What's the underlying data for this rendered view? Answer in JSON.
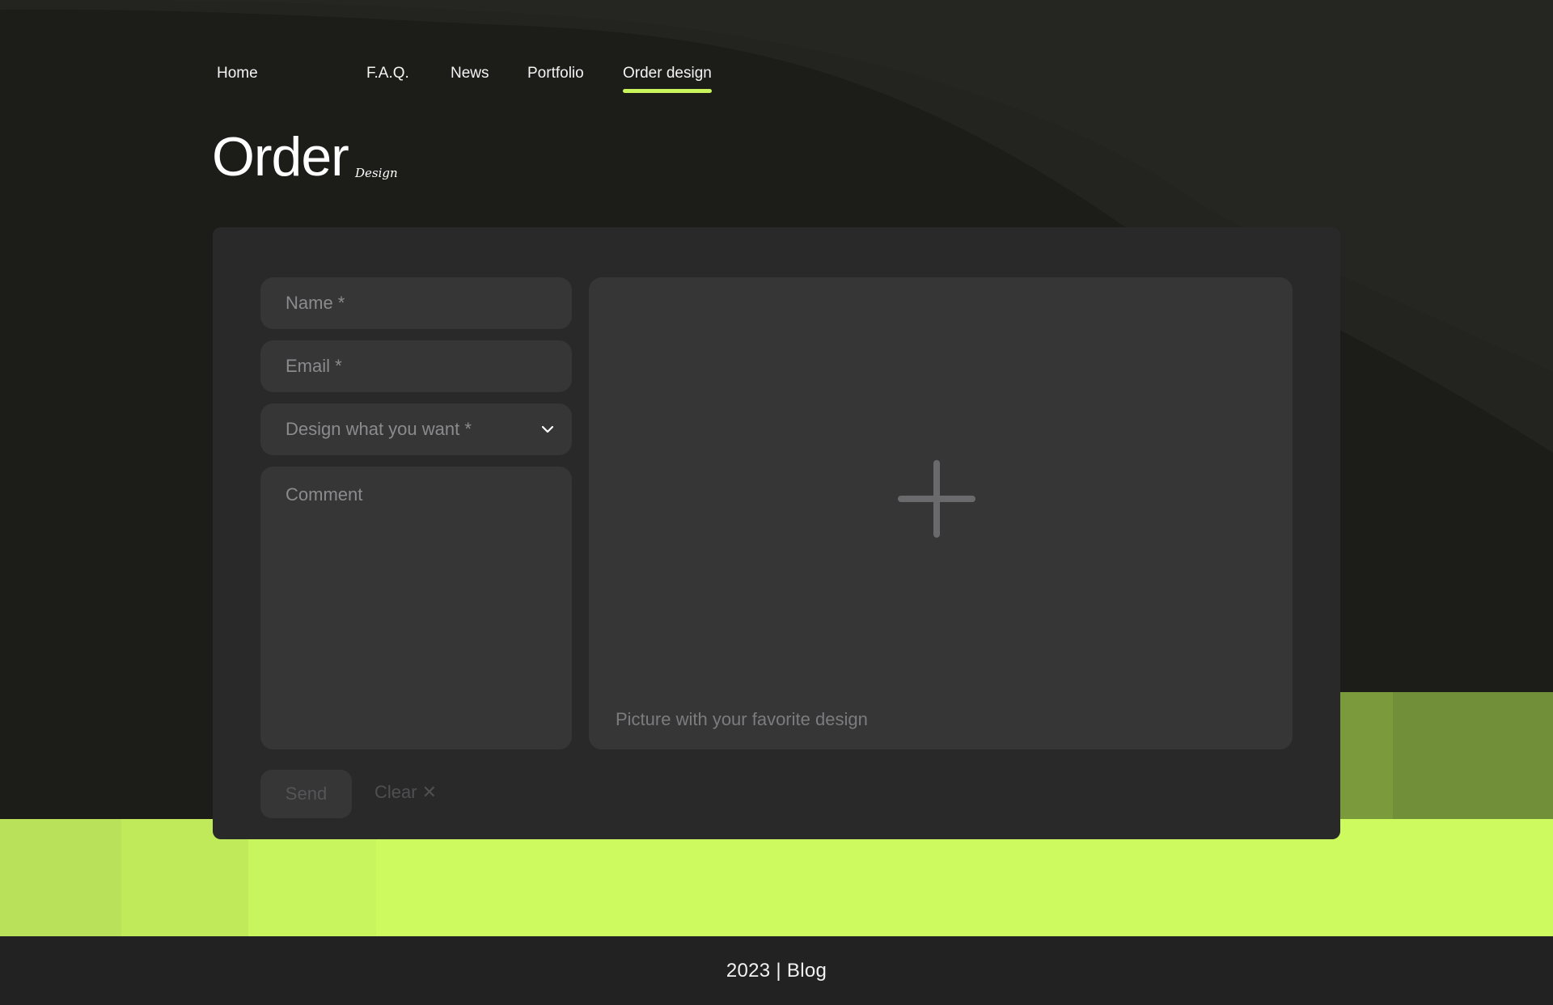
{
  "nav": {
    "items": [
      {
        "label": "Home"
      },
      {
        "label": "F.A.Q."
      },
      {
        "label": "News"
      },
      {
        "label": "Portfolio"
      },
      {
        "label": "Order design",
        "active": true
      }
    ]
  },
  "page": {
    "title": "Order",
    "subtitle": "Design"
  },
  "form": {
    "name_placeholder": "Name *",
    "email_placeholder": "Email *",
    "design_select_value": "Design what you want *",
    "comment_placeholder": "Comment",
    "upload_label": "Picture with your favorite design",
    "send_label": "Send",
    "clear_label": "Clear",
    "clear_icon": "✕"
  },
  "footer": {
    "text": "2023 | Blog"
  },
  "colors": {
    "accent": "#c9f45c",
    "background": "#1c1c19",
    "card": "#292929",
    "field": "#363637"
  },
  "icons": {
    "select_chevron": "chevron-down-icon",
    "upload": "plus-icon",
    "clear": "close-icon"
  }
}
